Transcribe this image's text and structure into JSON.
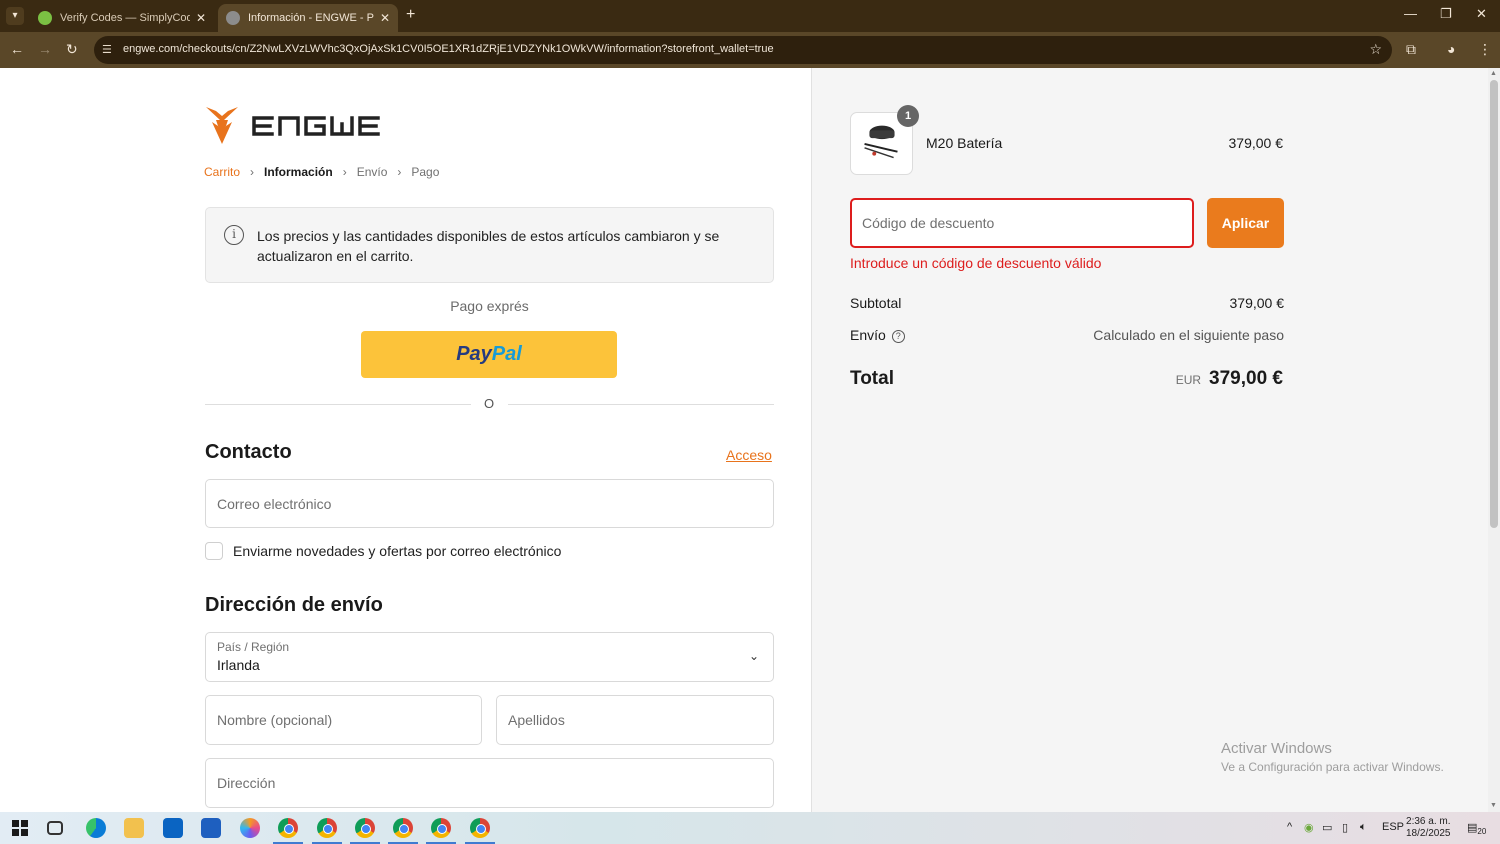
{
  "browser": {
    "tabs": [
      {
        "title": "Verify Codes — SimplyCodes",
        "active": false
      },
      {
        "title": "Información - ENGWE - Pantalla",
        "active": true
      }
    ],
    "url": "engwe.com/checkouts/cn/Z2NwLXVzLWVhc3QxOjAxSk1CV0I5OE1XR1dZRjE1VDZYNk1OWkVW/information?storefront_wallet=true"
  },
  "checkout": {
    "breadcrumb": {
      "cart": "Carrito",
      "info": "Información",
      "shipping": "Envío",
      "payment": "Pago"
    },
    "notice": "Los precios y las cantidades disponibles de estos artículos cambiaron y se actualizaron en el carrito.",
    "express_label": "Pago exprés",
    "paypal": {
      "pay": "Pay",
      "pal": "Pal"
    },
    "or": "O",
    "contact": {
      "heading": "Contacto",
      "login_link": "Acceso",
      "email_placeholder": "Correo electrónico",
      "newsletter_label": "Enviarme novedades y ofertas por correo electrónico"
    },
    "shipping": {
      "heading": "Dirección de envío",
      "country_label": "País / Región",
      "country_value": "Irlanda",
      "first_name_placeholder": "Nombre (opcional)",
      "last_name_placeholder": "Apellidos",
      "address_placeholder": "Dirección"
    }
  },
  "summary": {
    "product": {
      "name": "M20 Batería",
      "price": "379,00 €",
      "quantity": "1"
    },
    "discount": {
      "placeholder": "Código de descuento",
      "apply_label": "Aplicar",
      "error": "Introduce un código de descuento válido"
    },
    "subtotal_label": "Subtotal",
    "subtotal_value": "379,00 €",
    "shipping_label": "Envío",
    "shipping_value": "Calculado en el siguiente paso",
    "total_label": "Total",
    "total_currency": "EUR",
    "total_value": "379,00 €"
  },
  "windows_watermark": {
    "line1": "Activar Windows",
    "line2": "Ve a Configuración para activar Windows."
  },
  "taskbar": {
    "language": "ESP",
    "time": "2:36 a. m.",
    "date": "18/2/2025",
    "notifications": "20"
  },
  "colors": {
    "accent": "#ea7b1d",
    "error": "#dd1d1d",
    "paypal_yellow": "#fcc33a",
    "browser_frame": "#3a2a12"
  }
}
